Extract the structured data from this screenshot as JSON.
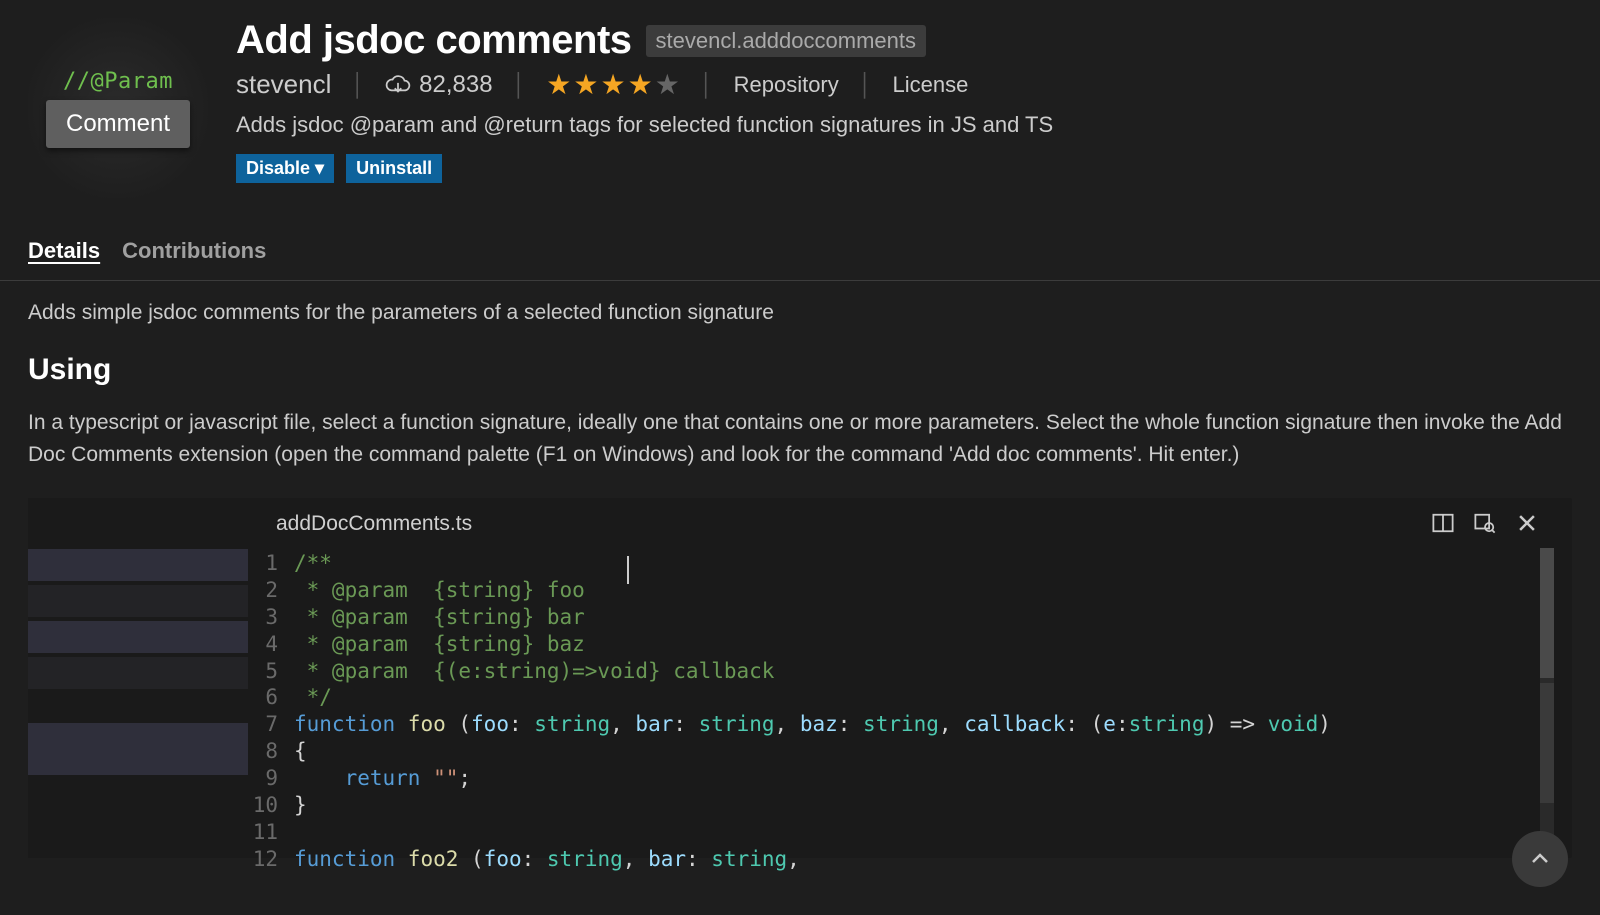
{
  "extension": {
    "title": "Add jsdoc comments",
    "identifier": "stevencl.adddoccomments",
    "publisher": "stevencl",
    "installs": "82,838",
    "star_rating": 4,
    "repository_label": "Repository",
    "license_label": "License",
    "description": "Adds jsdoc @param and @return tags for selected function signatures in JS and TS",
    "disable_label": "Disable ▾",
    "uninstall_label": "Uninstall",
    "icon_param_text": "//@Param",
    "icon_comment_text": "Comment"
  },
  "tabs": {
    "details": "Details",
    "contributions": "Contributions"
  },
  "details": {
    "intro": "Adds simple jsdoc comments for the parameters of a selected function signature",
    "using_heading": "Using",
    "using_paragraph": "In a typescript or javascript file, select a function signature, ideally one that contains one or more parameters. Select the whole function signature then invoke the Add Doc Comments extension (open the command palette (F1 on Windows) and look for the command 'Add doc comments'. Hit enter.)"
  },
  "code_preview": {
    "filename": "addDocComments.ts",
    "lines": [
      {
        "n": 1,
        "segments": [
          {
            "cls": "c-comment",
            "t": "/**"
          }
        ]
      },
      {
        "n": 2,
        "segments": [
          {
            "cls": "c-comment",
            "t": " * @param  {string} foo"
          }
        ]
      },
      {
        "n": 3,
        "segments": [
          {
            "cls": "c-comment",
            "t": " * @param  {string} bar"
          }
        ]
      },
      {
        "n": 4,
        "segments": [
          {
            "cls": "c-comment",
            "t": " * @param  {string} baz"
          }
        ]
      },
      {
        "n": 5,
        "segments": [
          {
            "cls": "c-comment",
            "t": " * @param  {(e:string)=>void} callback"
          }
        ]
      },
      {
        "n": 6,
        "segments": [
          {
            "cls": "c-comment",
            "t": " */"
          }
        ]
      },
      {
        "n": 7,
        "segments": [
          {
            "cls": "c-kw",
            "t": "function "
          },
          {
            "cls": "c-fn",
            "t": "foo "
          },
          {
            "cls": "c-punc",
            "t": "("
          },
          {
            "cls": "c-var",
            "t": "foo"
          },
          {
            "cls": "c-punc",
            "t": ": "
          },
          {
            "cls": "c-type",
            "t": "string"
          },
          {
            "cls": "c-punc",
            "t": ", "
          },
          {
            "cls": "c-var",
            "t": "bar"
          },
          {
            "cls": "c-punc",
            "t": ": "
          },
          {
            "cls": "c-type",
            "t": "string"
          },
          {
            "cls": "c-punc",
            "t": ", "
          },
          {
            "cls": "c-var",
            "t": "baz"
          },
          {
            "cls": "c-punc",
            "t": ": "
          },
          {
            "cls": "c-type",
            "t": "string"
          },
          {
            "cls": "c-punc",
            "t": ", "
          },
          {
            "cls": "c-var",
            "t": "callback"
          },
          {
            "cls": "c-punc",
            "t": ": ("
          },
          {
            "cls": "c-var",
            "t": "e"
          },
          {
            "cls": "c-punc",
            "t": ":"
          },
          {
            "cls": "c-type",
            "t": "string"
          },
          {
            "cls": "c-punc",
            "t": ") => "
          },
          {
            "cls": "c-type",
            "t": "void"
          },
          {
            "cls": "c-punc",
            "t": ")"
          }
        ]
      },
      {
        "n": 8,
        "segments": [
          {
            "cls": "c-punc",
            "t": "{"
          }
        ]
      },
      {
        "n": 9,
        "segments": [
          {
            "cls": "c-punc",
            "t": "    "
          },
          {
            "cls": "c-kw",
            "t": "return "
          },
          {
            "cls": "c-str",
            "t": "\"\""
          },
          {
            "cls": "c-punc",
            "t": ";"
          }
        ]
      },
      {
        "n": 10,
        "segments": [
          {
            "cls": "c-punc",
            "t": "}"
          }
        ]
      },
      {
        "n": 11,
        "segments": [
          {
            "cls": "c-punc",
            "t": ""
          }
        ]
      },
      {
        "n": 12,
        "segments": [
          {
            "cls": "c-kw",
            "t": "function "
          },
          {
            "cls": "c-fn",
            "t": "foo2 "
          },
          {
            "cls": "c-punc",
            "t": "("
          },
          {
            "cls": "c-var",
            "t": "foo"
          },
          {
            "cls": "c-punc",
            "t": ": "
          },
          {
            "cls": "c-type",
            "t": "string"
          },
          {
            "cls": "c-punc",
            "t": ", "
          },
          {
            "cls": "c-var",
            "t": "bar"
          },
          {
            "cls": "c-punc",
            "t": ": "
          },
          {
            "cls": "c-type",
            "t": "string"
          },
          {
            "cls": "c-punc",
            "t": ","
          }
        ]
      }
    ]
  }
}
